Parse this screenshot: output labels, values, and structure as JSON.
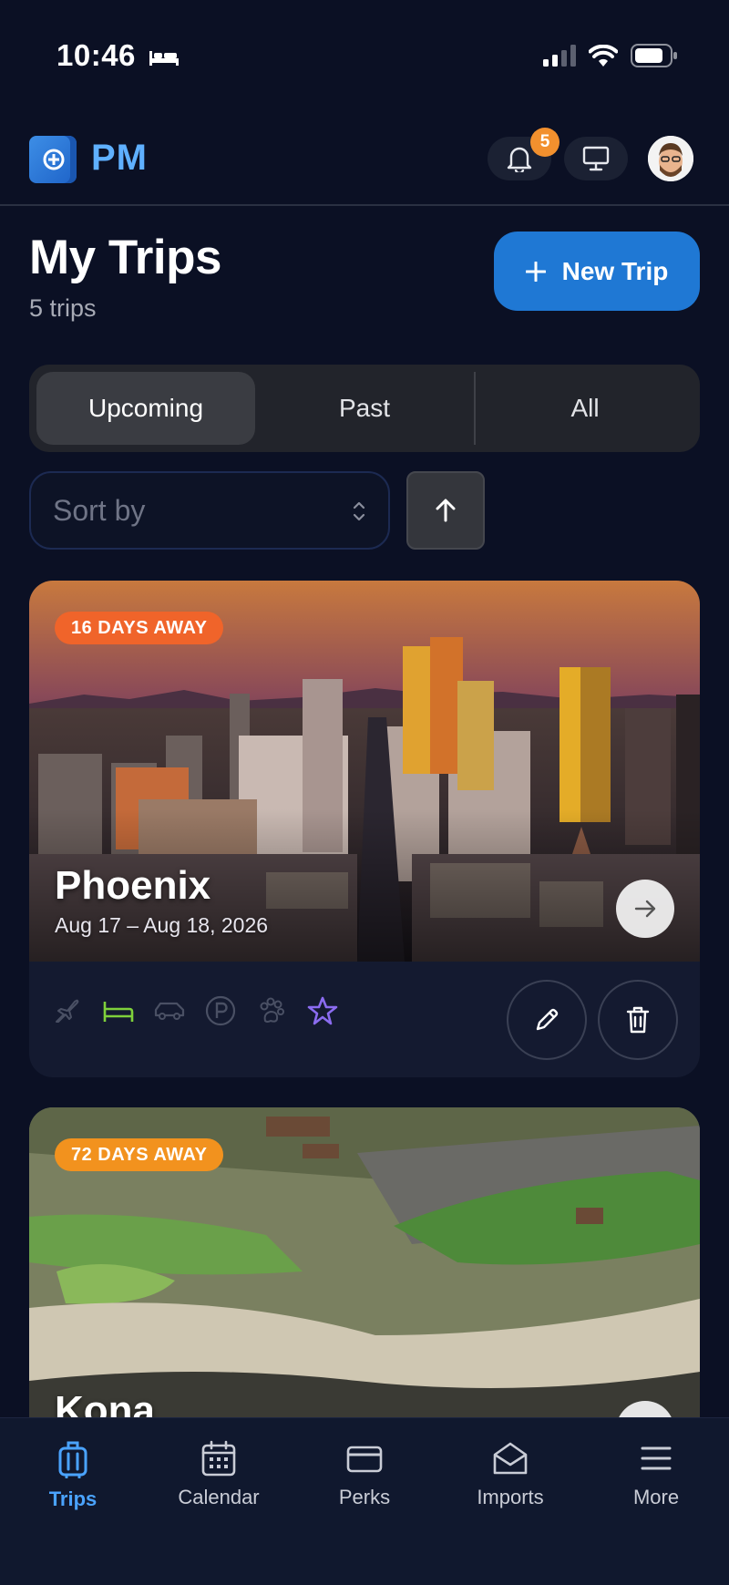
{
  "status_bar": {
    "time": "10:46"
  },
  "header": {
    "app_name": "PM",
    "notification_count": "5"
  },
  "page": {
    "title": "My Trips",
    "subtitle": "5 trips",
    "new_trip_label": "New Trip"
  },
  "filters": {
    "tabs": [
      {
        "label": "Upcoming",
        "selected": true
      },
      {
        "label": "Past",
        "selected": false
      },
      {
        "label": "All",
        "selected": false
      }
    ],
    "sort_placeholder": "Sort by",
    "sort_direction": "ascending"
  },
  "trips": [
    {
      "name": "Phoenix",
      "dates": "Aug 17 – Aug 18, 2026",
      "away_label": "16 DAYS AWAY",
      "away_color": "#f0642a",
      "amenities": [
        {
          "icon": "plane-icon",
          "active": false
        },
        {
          "icon": "bed-icon",
          "active": true,
          "color": "#7fd13b"
        },
        {
          "icon": "car-icon",
          "active": false
        },
        {
          "icon": "parking-icon",
          "active": false
        },
        {
          "icon": "paw-icon",
          "active": false
        },
        {
          "icon": "star-icon",
          "active": true,
          "color": "#8b6cf0"
        }
      ]
    },
    {
      "name": "Kona",
      "away_label": "72 DAYS AWAY",
      "away_color": "#f2921e"
    }
  ],
  "bottom_nav": [
    {
      "label": "Trips",
      "icon": "suitcase-icon",
      "active": true
    },
    {
      "label": "Calendar",
      "icon": "calendar-icon",
      "active": false
    },
    {
      "label": "Perks",
      "icon": "credit-card-icon",
      "active": false
    },
    {
      "label": "Imports",
      "icon": "envelope-open-icon",
      "active": false
    },
    {
      "label": "More",
      "icon": "menu-icon",
      "active": false
    }
  ],
  "colors": {
    "accent": "#1f78d4",
    "background": "#0b1024",
    "nav_active": "#4aa3ff"
  }
}
